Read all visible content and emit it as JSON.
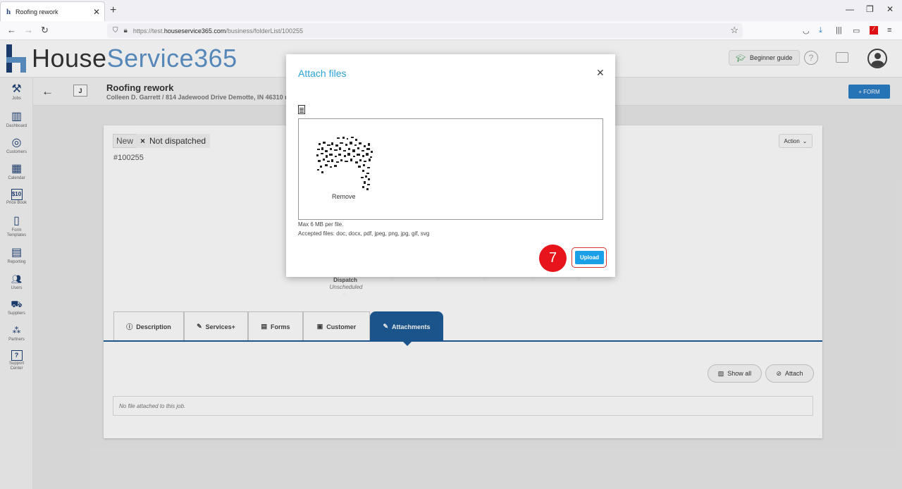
{
  "browser": {
    "tab_title": "Roofing rework",
    "url_prefix": "https://test.",
    "url_domain": "houseservice365.com",
    "url_path": "/business/folderList/100255"
  },
  "header": {
    "logo_part1": "House",
    "logo_part2": "Service365",
    "guide_label": "Beginner guide",
    "help_icon": "question-circle-icon",
    "folder_icon": "folder-icon",
    "avatar_icon": "user-avatar-icon"
  },
  "sidebar": {
    "items": [
      {
        "label": "Jobs",
        "icon": "tools-icon"
      },
      {
        "label": "Dashboard",
        "icon": "bar-chart-icon"
      },
      {
        "label": "Customers",
        "icon": "target-icon"
      },
      {
        "label": "Calendar",
        "icon": "calendar-icon"
      },
      {
        "label": "Price Book",
        "icon": "price-tag-icon"
      },
      {
        "label": "Form Templates",
        "icon": "form-icon"
      },
      {
        "label": "Reporting",
        "icon": "report-icon"
      },
      {
        "label": "Users",
        "icon": "users-icon"
      },
      {
        "label": "Suppliers",
        "icon": "truck-icon"
      },
      {
        "label": "Partners",
        "icon": "partners-icon"
      },
      {
        "label": "Support Center",
        "icon": "support-icon"
      }
    ]
  },
  "job": {
    "badge": "J",
    "title": "Roofing rework",
    "subtitle": "Colleen D. Garrett / 814 Jadewood Drive Demotte, IN 46310 re",
    "form_button": "+ FORM",
    "status_new": "New",
    "status_dispatch": "Not dispatched",
    "number": "#100255",
    "action_label": "Action",
    "dispatch_label": "Dispatch",
    "dispatch_status": "Unscheduled"
  },
  "tabs": [
    {
      "label": "Description",
      "icon": "info-icon"
    },
    {
      "label": "Services+",
      "icon": "pencil-icon"
    },
    {
      "label": "Forms",
      "icon": "document-icon"
    },
    {
      "label": "Customer",
      "icon": "id-card-icon"
    },
    {
      "label": "Attachments",
      "icon": "paperclip-icon"
    }
  ],
  "attachments": {
    "show_all": "Show all",
    "attach": "Attach",
    "empty_text": "No file attached to this job."
  },
  "modal": {
    "title": "Attach files",
    "remove_label": "Remove",
    "max_size": "Max 6 MB per file.",
    "accepted": "Accepted files: doc, docx, pdf, jpeg, png, jpg, gif, svg",
    "upload_label": "Upload",
    "step_number": "7"
  },
  "colors": {
    "brand_dark": "#1d3f73",
    "brand_light": "#5d93c8",
    "accent": "#2aa3d6",
    "upload": "#1aa0e6",
    "badge": "#e8141b"
  }
}
